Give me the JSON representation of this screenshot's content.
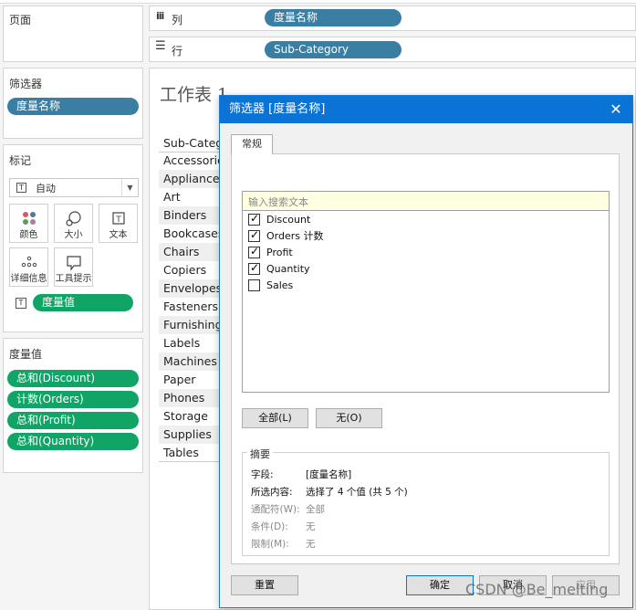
{
  "left": {
    "pages": {
      "title": "页面"
    },
    "filters": {
      "title": "筛选器",
      "pill": "度量名称"
    },
    "marks": {
      "title": "标记",
      "type_select": "自动",
      "buttons": [
        {
          "label": "颜色",
          "icon": "color-dots-icon"
        },
        {
          "label": "大小",
          "icon": "size-icon"
        },
        {
          "label": "文本",
          "icon": "text-icon"
        },
        {
          "label": "详细信息",
          "icon": "detail-dots-icon"
        },
        {
          "label": "工具提示",
          "icon": "tooltip-icon"
        }
      ],
      "text_pill": "度量值"
    },
    "measure_values": {
      "title": "度量值",
      "pills": [
        "总和(Discount)",
        "计数(Orders)",
        "总和(Profit)",
        "总和(Quantity)"
      ]
    }
  },
  "shelves": {
    "columns_label": "列",
    "columns_pill": "度量名称",
    "rows_label": "行",
    "rows_pill": "Sub-Category"
  },
  "sheet": {
    "title": "工作表 1",
    "header": "Sub-Category",
    "rows": [
      "Accessories",
      "Appliances",
      "Art",
      "Binders",
      "Bookcases",
      "Chairs",
      "Copiers",
      "Envelopes",
      "Fasteners",
      "Furnishings",
      "Labels",
      "Machines",
      "Paper",
      "Phones",
      "Storage",
      "Supplies",
      "Tables"
    ]
  },
  "dialog": {
    "title": "筛选器 [度量名称]",
    "tab": "常规",
    "search_placeholder": "输入搜索文本",
    "items": [
      {
        "label": "Discount",
        "checked": true
      },
      {
        "label": "Orders 计数",
        "checked": true
      },
      {
        "label": "Profit",
        "checked": true
      },
      {
        "label": "Quantity",
        "checked": true
      },
      {
        "label": "Sales",
        "checked": false
      }
    ],
    "all_button": "全部(L)",
    "none_button": "无(O)",
    "summary": {
      "title": "摘要",
      "rows": [
        {
          "key": "字段:",
          "value": "[度量名称]",
          "dim": false
        },
        {
          "key": "所选内容:",
          "value": "选择了 4 个值 (共 5 个)",
          "dim": false
        },
        {
          "key": "通配符(W):",
          "value": "全部",
          "dim": true
        },
        {
          "key": "条件(D):",
          "value": "无",
          "dim": true
        },
        {
          "key": "限制(M):",
          "value": "无",
          "dim": true
        }
      ]
    },
    "reset_button": "重置",
    "ok_button": "确定",
    "cancel_button": "取消",
    "apply_button": "应用"
  },
  "watermark": "CSDN @Be_melting"
}
